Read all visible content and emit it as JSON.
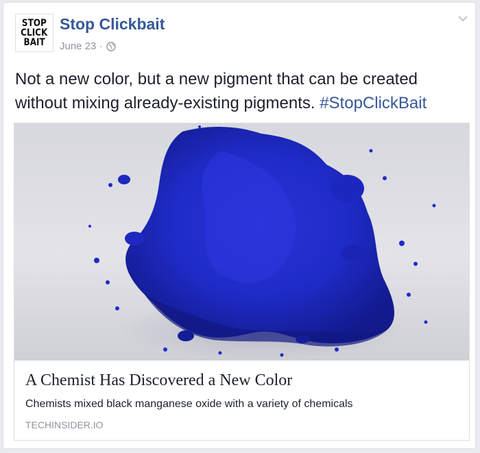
{
  "post": {
    "page_name": "Stop Clickbait",
    "avatar_lines": [
      "STOP",
      "CLICK",
      "BAIT"
    ],
    "date": "June 23",
    "separator": "·",
    "privacy_icon": "globe-icon",
    "menu_icon": "chevron-down-icon",
    "message_text": "Not a new color, but a new pigment that can be created without mixing already-existing pigments. ",
    "hashtag": "#StopClickBait"
  },
  "link": {
    "title": "A Chemist Has Discovered a New Color",
    "description": "Chemists mixed black manganese oxide with a variety of chemicals",
    "domain": "TECHINSIDER.IO"
  },
  "colors": {
    "brand_link": "#365899",
    "secondary_text": "#90949c",
    "pigment_blue": "#1f2bc7"
  }
}
